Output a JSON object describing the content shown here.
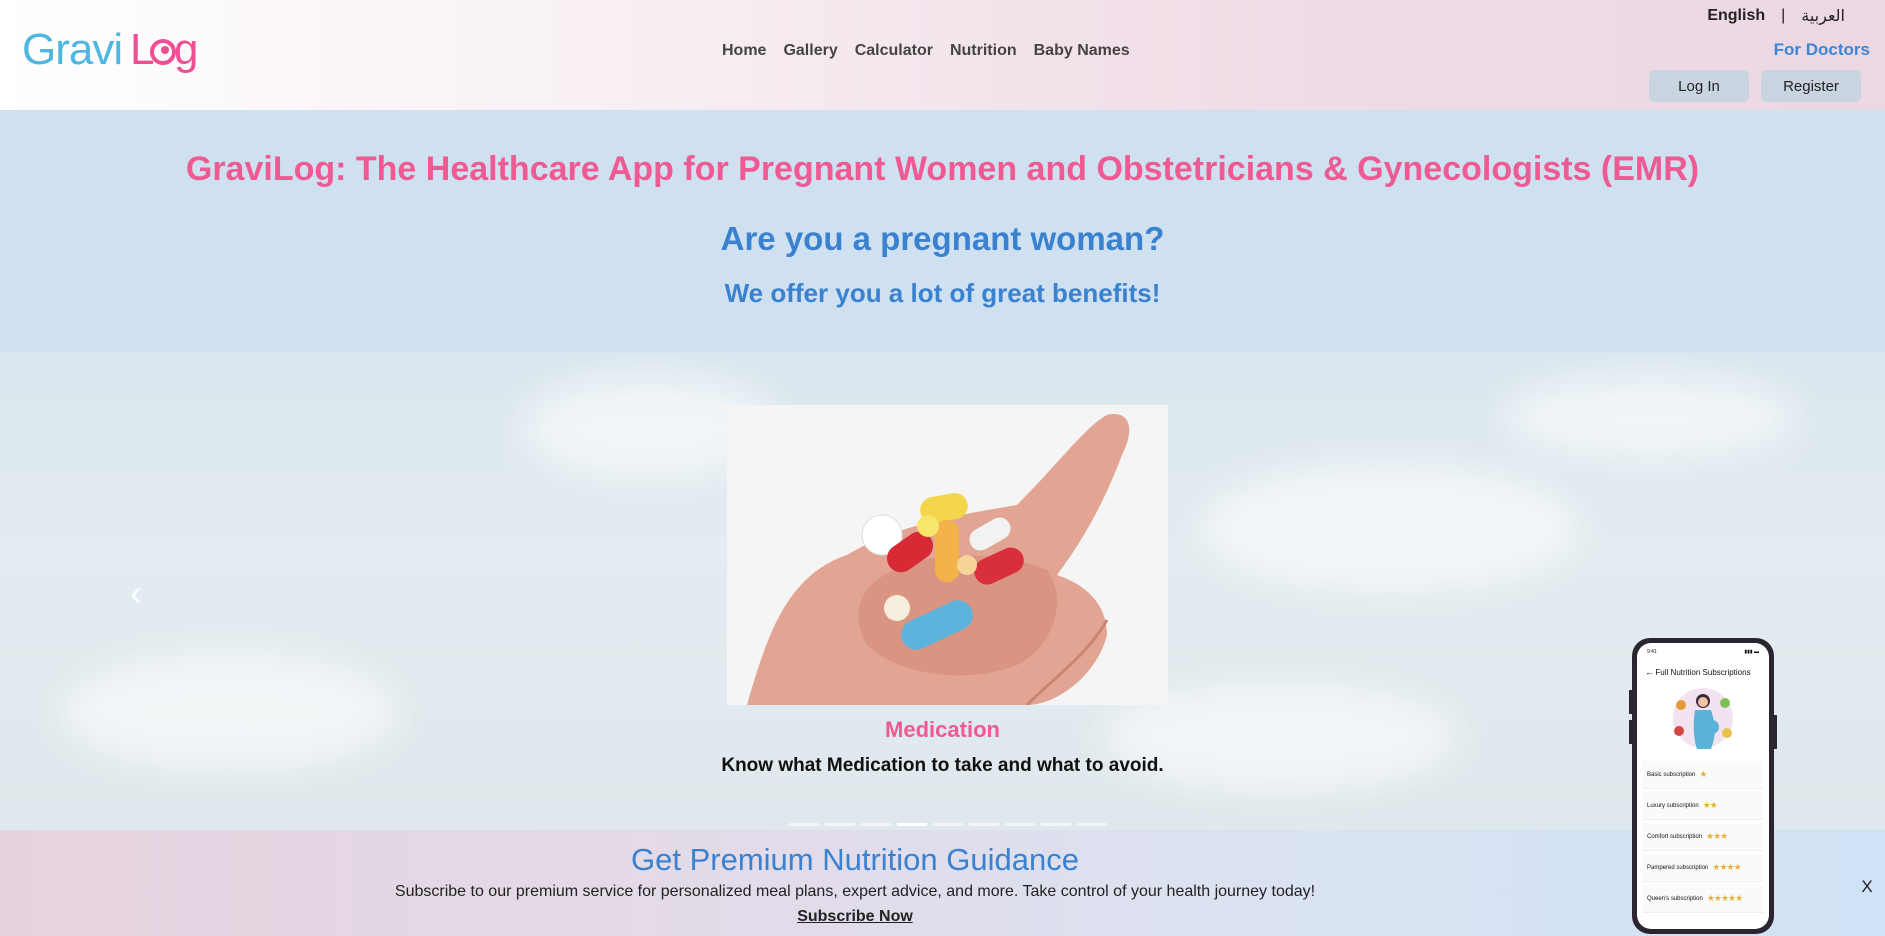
{
  "header": {
    "logo": "GraviLog",
    "nav": [
      "Home",
      "Gallery",
      "Calculator",
      "Nutrition",
      "Baby Names"
    ],
    "lang_en": "English",
    "lang_sep": "|",
    "lang_ar": "العربية",
    "for_doctors": "For Doctors",
    "login": "Log In",
    "register": "Register"
  },
  "hero": {
    "title": "GraviLog: The Healthcare App for Pregnant Women and Obstetricians & Gynecologists (EMR)",
    "question": "Are you a pregnant woman?",
    "subtitle": "We offer you a lot of great benefits!"
  },
  "carousel": {
    "slide_title": "Medication",
    "slide_desc": "Know what Medication to take and what to avoid.",
    "dot_count": 9,
    "active_dot": 4
  },
  "promo": {
    "title": "Get Premium Nutrition Guidance",
    "text": "Subscribe to our premium service for personalized meal plans, expert advice, and more. Take control of your health journey today!",
    "link": "Subscribe Now",
    "close": "X"
  },
  "phone": {
    "time": "9:41",
    "header": "Full Nutrition Subscriptions",
    "subscriptions": [
      {
        "name": "Basic subscription",
        "stars": "★"
      },
      {
        "name": "Luxury subscription",
        "stars": "★★"
      },
      {
        "name": "Comfort subscription",
        "stars": "★★★"
      },
      {
        "name": "Pampered subscription",
        "stars": "★★★★"
      },
      {
        "name": "Queen's subscription",
        "stars": "★★★★★"
      }
    ]
  },
  "colors": {
    "pink": "#ef5a93",
    "blue": "#3a82cf",
    "logo_blue": "#4fb6e0"
  }
}
